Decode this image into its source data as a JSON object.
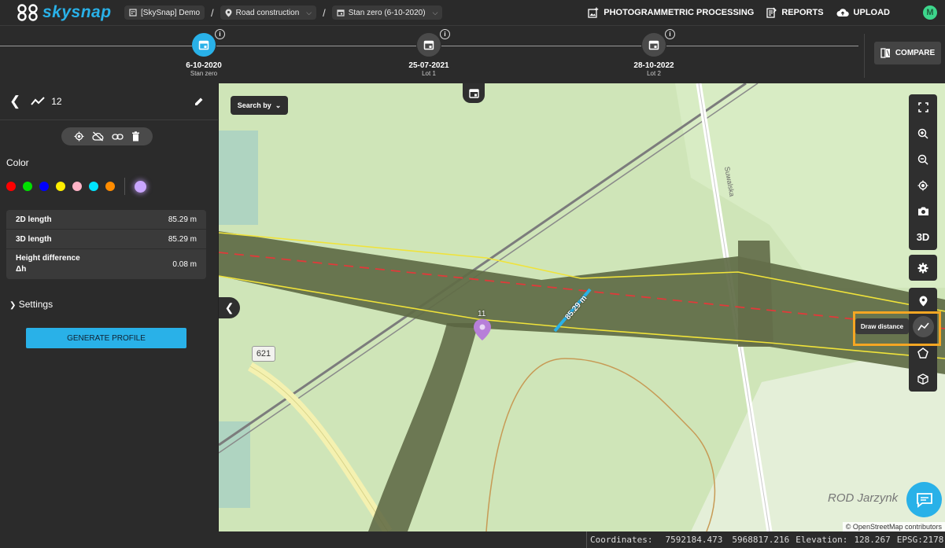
{
  "brand": {
    "name": "skysnap"
  },
  "breadcrumb": [
    {
      "label": "[SkySnap] Demo",
      "icon": "building-icon"
    },
    {
      "label": "Road construction",
      "icon": "pin-icon"
    },
    {
      "label": "Stan zero (6-10-2020)",
      "icon": "calendar-icon"
    }
  ],
  "header": {
    "photogrammetric": "PHOTOGRAMMETRIC PROCESSING",
    "reports": "REPORTS",
    "upload": "UPLOAD",
    "avatar": "M"
  },
  "timeline": {
    "nodes": [
      {
        "date": "6-10-2020",
        "sub": "Stan zero",
        "active": true
      },
      {
        "date": "25-07-2021",
        "sub": "Lot 1",
        "active": false
      },
      {
        "date": "28-10-2022",
        "sub": "Lot 2",
        "active": false
      }
    ],
    "compare_label": "COMPARE"
  },
  "panel": {
    "measure_id": "12",
    "color_label": "Color",
    "colors": [
      "#ff0000",
      "#00e000",
      "#0000ff",
      "#ffee00",
      "#ffb3c6",
      "#00e5ff",
      "#ff8c00",
      "#c9a6ff"
    ],
    "selected_color": "#c9a6ff",
    "measurements": [
      {
        "label": "2D length",
        "value": "85.29 m"
      },
      {
        "label": "3D length",
        "value": "85.29 m"
      },
      {
        "label": "Height difference Δh",
        "value": "0.08 m"
      }
    ],
    "settings_label": "Settings",
    "generate_label": "GENERATE PROFILE"
  },
  "map": {
    "search_by": "Search by",
    "line_label": "85.29 m",
    "marker_label": "11",
    "road_number": "621",
    "street_label": "Suwalska",
    "place_label": "ROD Jarzynk",
    "tooltip": "Draw distance",
    "tool_3d": "3D",
    "attribution": "© OpenStreetMap contributors"
  },
  "status": {
    "coordinates_label": "Coordinates:",
    "x": "7592184.473",
    "y": "5968817.216",
    "elevation_label": "Elevation:",
    "elevation": "128.267",
    "epsg": "EPSG:2178"
  }
}
